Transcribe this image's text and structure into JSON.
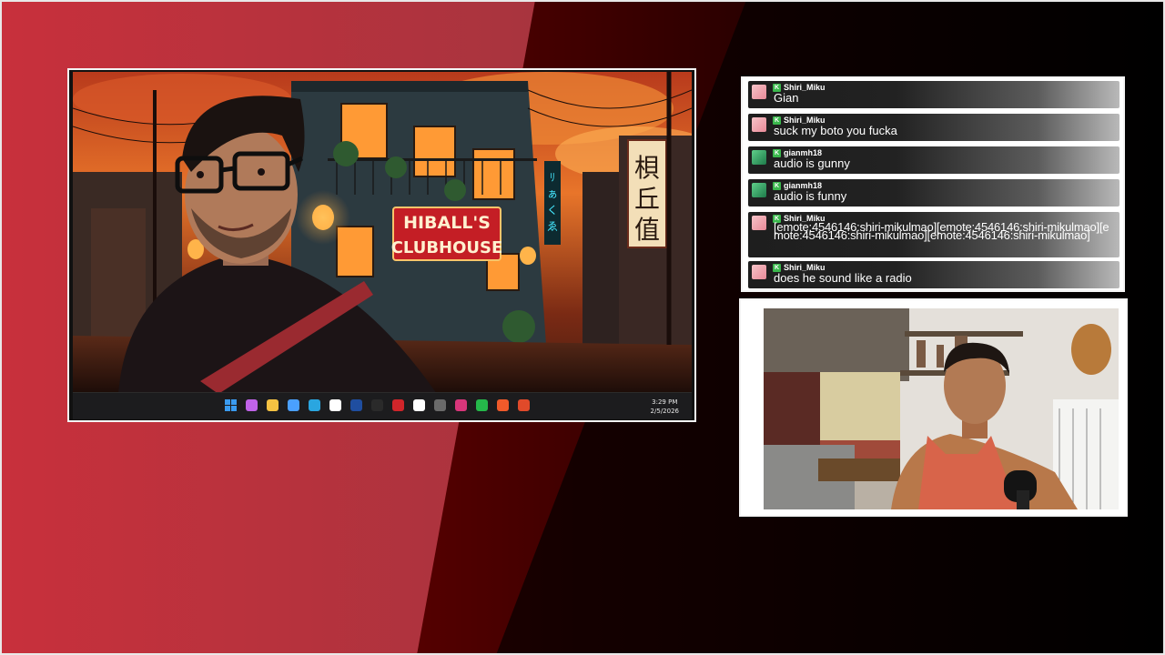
{
  "screen": {
    "sign_line1": "HIBALL'S",
    "sign_line2": "CLUBHOUSE",
    "vertical_sign": "梖丘值",
    "neon_sign": "ﾘぁくゑ",
    "taskbar": {
      "icons": [
        "windows-start-icon",
        "copilot-icon",
        "file-explorer-icon",
        "notepad-icon",
        "edge-browser-icon",
        "capcut-icon",
        "steam-icon",
        "epic-games-icon",
        "mcafee-icon",
        "app-icon",
        "obs-icon",
        "instagram-icon",
        "whatsapp-icon",
        "chrome-icon",
        "news-icon"
      ],
      "time": "3:29 PM",
      "date": "2/5/2026"
    }
  },
  "chat": {
    "messages": [
      {
        "user": "Shiri_Miku",
        "text": "Gian",
        "avatar": "pink"
      },
      {
        "user": "Shiri_Miku",
        "text": "suck my boto you fucka",
        "avatar": "pink"
      },
      {
        "user": "gianmh18",
        "text": "audio is gunny",
        "avatar": "green"
      },
      {
        "user": "gianmh18",
        "text": "audio is funny",
        "avatar": "green"
      },
      {
        "user": "Shiri_Miku",
        "text": "[emote:4546146:shiri-mikulmao][emote:4546146:shiri-mikulmao][emote:4546146:shiri-mikulmao][emote:4546146:shiri-mikulmao]",
        "avatar": "pink"
      },
      {
        "user": "Shiri_Miku",
        "text": "does he sound like a radio",
        "avatar": "pink"
      }
    ]
  },
  "colors": {
    "background_red": "#c4303a",
    "background_dark": "#050000",
    "badge_green": "#3bb84d",
    "frame_border": "#f4f4f4"
  }
}
